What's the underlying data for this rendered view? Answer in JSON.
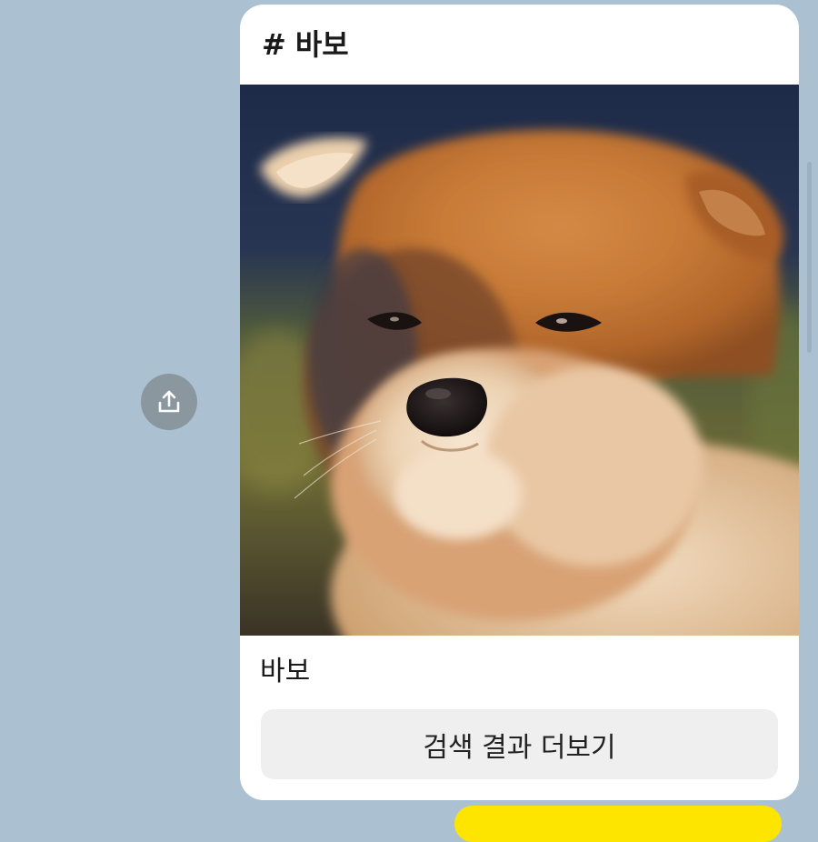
{
  "chat": {
    "background_color": "#abc1d1",
    "share_icon": "share-upload-icon",
    "card": {
      "hash_symbol": "#",
      "title": "바보",
      "image_description_icon": "shiba-puppy-photo",
      "caption": "바보",
      "more_button_label": "검색 결과 더보기"
    },
    "next_bubble_color": "#fee500"
  }
}
